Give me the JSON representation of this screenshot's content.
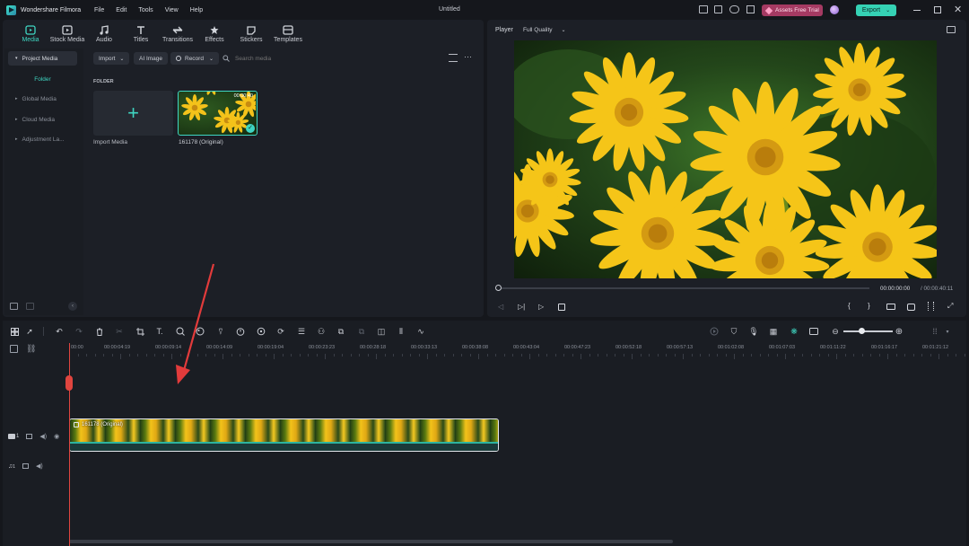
{
  "app": {
    "name": "Wondershare Filmora",
    "document_title": "Untitled"
  },
  "menu": [
    "File",
    "Edit",
    "Tools",
    "View",
    "Help"
  ],
  "header": {
    "assets_label": "Assets Free Trial",
    "export_label": "Export"
  },
  "media_tabs": [
    {
      "label": "Media",
      "icon": "media-icon",
      "active": true
    },
    {
      "label": "Stock Media",
      "icon": "stock-media-icon"
    },
    {
      "label": "Audio",
      "icon": "music-note-icon"
    },
    {
      "label": "Titles",
      "icon": "titles-icon"
    },
    {
      "label": "Transitions",
      "icon": "transitions-icon"
    },
    {
      "label": "Effects",
      "icon": "effects-icon"
    },
    {
      "label": "Stickers",
      "icon": "stickers-icon"
    },
    {
      "label": "Templates",
      "icon": "templates-icon"
    }
  ],
  "sidebar": {
    "items": [
      {
        "label": "Project Media",
        "active": true
      },
      {
        "label": "Folder",
        "sub": true
      },
      {
        "label": "Global Media"
      },
      {
        "label": "Cloud Media"
      },
      {
        "label": "Adjustment La..."
      }
    ]
  },
  "toolbar": {
    "import_label": "Import",
    "ai_image_label": "AI Image",
    "record_label": "Record",
    "search_placeholder": "Search media"
  },
  "library": {
    "folder_label": "FOLDER",
    "import_tile_label": "Import Media",
    "clip": {
      "name": "161178 (Original)",
      "duration": "00:00:40"
    }
  },
  "player": {
    "label": "Player",
    "quality": "Full Quality",
    "current_time": "00:00:00:00",
    "total_time": "/ 00:00:40:11",
    "progress": 0
  },
  "timeline": {
    "ruler": [
      "00:00",
      "00:00:04:19",
      "00:00:09:14",
      "00:00:14:09",
      "00:00:19:04",
      "00:00:23:23",
      "00:00:28:18",
      "00:00:33:13",
      "00:00:38:08",
      "00:00:43:04",
      "00:00:47:23",
      "00:00:52:18",
      "00:00:57:13",
      "00:01:02:08",
      "00:01:07:03",
      "00:01:11:22",
      "00:01:16:17",
      "00:01:21:12"
    ],
    "video_clip_label": "161178 (Original)",
    "video_track_number": "1",
    "audio_track_number": "1"
  },
  "colors": {
    "accent": "#3fd6c2",
    "export_bg": "#35d2b4",
    "assets_bg": "#a53a62",
    "playhead": "#e0453f",
    "annotation_arrow": "#e23b3b"
  }
}
